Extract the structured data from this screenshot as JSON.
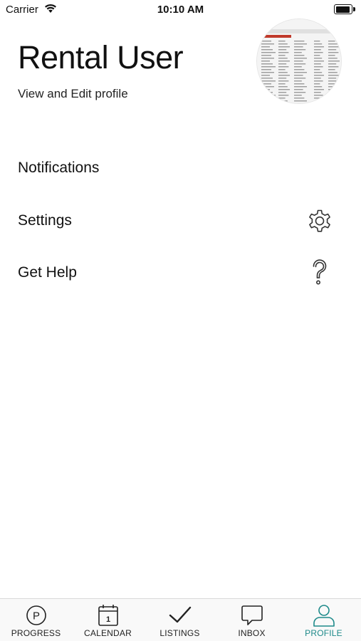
{
  "status_bar": {
    "carrier": "Carrier",
    "time": "10:10 AM"
  },
  "profile": {
    "name": "Rental User",
    "edit_link": "View and Edit profile"
  },
  "menu": [
    {
      "label": "Notifications",
      "icon": "none"
    },
    {
      "label": "Settings",
      "icon": "gear-icon"
    },
    {
      "label": "Get Help",
      "icon": "question-icon"
    }
  ],
  "tab_bar": {
    "tabs": [
      {
        "label": "PROGRESS",
        "icon": "progress-icon",
        "active": false
      },
      {
        "label": "CALENDAR",
        "icon": "calendar-icon",
        "active": false,
        "icon_text": "1"
      },
      {
        "label": "LISTINGS",
        "icon": "checkmark-icon",
        "active": false
      },
      {
        "label": "INBOX",
        "icon": "chat-bubble-icon",
        "active": false
      },
      {
        "label": "PROFILE",
        "icon": "person-icon",
        "active": true
      }
    ],
    "active_color": "#1e8a8a"
  }
}
